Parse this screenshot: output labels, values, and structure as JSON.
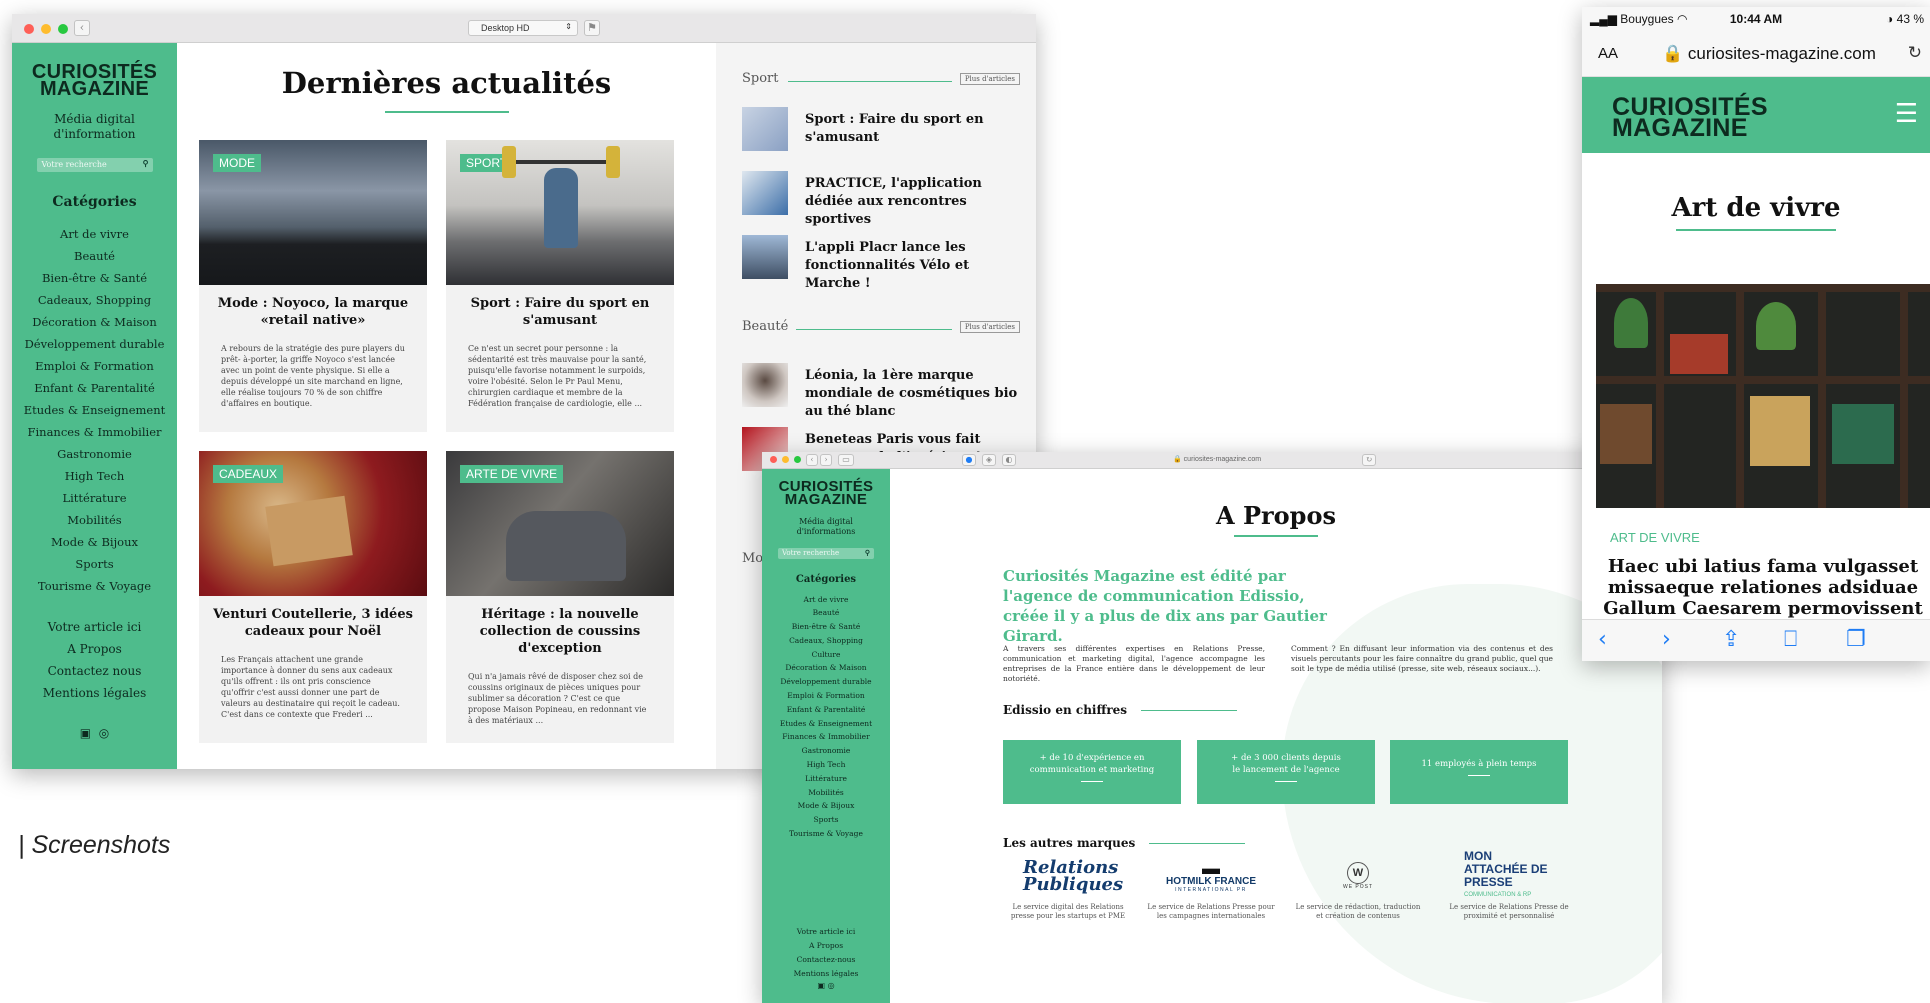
{
  "caption": "| Screenshots",
  "logo": {
    "line1": "CURIOSITÉS",
    "line2": "MAGAZINE"
  },
  "window1": {
    "device_select": "Desktop HD",
    "sidebar": {
      "tagline1": "Média digital",
      "tagline2": "d'information",
      "search_placeholder": "Votre recherche",
      "categories_title": "Catégories",
      "categories": [
        "Art de vivre",
        "Beauté",
        "Bien-être & Santé",
        "Cadeaux, Shopping",
        "Décoration & Maison",
        "Développement durable",
        "Emploi & Formation",
        "Enfant & Parentalité",
        "Etudes & Enseignement",
        "Finances & Immobilier",
        "Gastronomie",
        "High Tech",
        "Littérature",
        "Mobilités",
        "Mode & Bijoux",
        "Sports",
        "Tourisme & Voyage"
      ],
      "extra": [
        "Votre article ici",
        "A Propos",
        "Contactez nous",
        "Mentions légales"
      ]
    },
    "main": {
      "title": "Dernières actualités",
      "cards": [
        {
          "badge": "MODE",
          "title": "Mode : Noyoco, la marque «retail native»",
          "excerpt": "A rebours de la stratégie des pure players du prêt- à-porter, la griffe Noyoco s'est lancée avec un point de vente physique. Si elle a depuis développé un site marchand en ligne, elle réalise toujours 70 % de son chiffre d'affaires en boutique."
        },
        {
          "badge": "SPORT",
          "title": "Sport : Faire du sport en s'amusant",
          "excerpt": "Ce n'est un secret pour personne : la sédentarité est très mauvaise pour la santé, puisqu'elle favorise notamment le surpoids, voire l'obésité. Selon le Pr Paul Menu, chirurgien cardiaque et membre de la Fédération française de cardiologie, elle ..."
        },
        {
          "badge": "CADEAUX",
          "title": "Venturi Coutellerie, 3 idées cadeaux pour Noël",
          "excerpt": "Les Français attachent une grande importance à donner du sens aux cadeaux qu'ils offrent : ils ont pris conscience qu'offrir c'est aussi donner une part de valeurs au destinataire qui reçoit le cadeau. C'est dans ce contexte que Frederi ..."
        },
        {
          "badge": "ARTE DE VIVRE",
          "title": "Héritage : la nouvelle collection de coussins d'exception",
          "excerpt": "Qui n'a jamais rêvé de disposer chez soi de coussins originaux de pièces uniques pour sublimer sa décoration ? C'est ce que propose Maison Popineau, en redonnant vie à des matériaux ..."
        }
      ]
    },
    "rail": {
      "sport_label": "Sport",
      "beaute_label": "Beauté",
      "mode_label": "Mode",
      "more_label": "Plus d'articles",
      "sport_articles": [
        "Sport : Faire du sport en s'amusant",
        "PRACTICE, l'application dédiée aux rencontres sportives",
        "L'appli Placr lance les fonctionnalités Vélo et Marche !"
      ],
      "beaute_articles": [
        "Léonia, la 1ère marque mondiale de cosmétiques bio au thé blanc",
        "Beneteas Paris vous fait rayonner de l'intérieur !"
      ]
    }
  },
  "window2": {
    "url": "curiosites-magazine.com",
    "sidebar": {
      "tagline1": "Média digital",
      "tagline2": "d'informations",
      "search_placeholder": "Votre recherche",
      "categories_title": "Catégories",
      "categories": [
        "Art de vivre",
        "Beauté",
        "Bien-être & Santé",
        "Cadeaux, Shopping",
        "Culture",
        "Décoration & Maison",
        "Développement durable",
        "Emploi & Formation",
        "Enfant & Parentalité",
        "Etudes & Enseignement",
        "Finances & Immobilier",
        "Gastronomie",
        "High Tech",
        "Littérature",
        "Mobilités",
        "Mode & Bijoux",
        "Sports",
        "Tourisme & Voyage"
      ],
      "extra": [
        "Votre article ici",
        "A Propos",
        "Contactez-nous",
        "Mentions légales"
      ]
    },
    "title": "A Propos",
    "lead": "Curiosités Magazine est édité par l'agence de communication Edissio, créée il y a plus de dix ans par Gautier Girard.",
    "col1": "A travers ses différentes expertises en Relations Presse, communication et marketing digital, l'agence accompagne les entreprises de la France entière dans le développement de leur notoriété.",
    "col2": "Comment ? En diffusant leur information via des contenus et des visuels percutants pour les faire connaître du grand public, quel que soit le type de média utilisé (presse, site web, réseaux sociaux...).",
    "stats_title": "Edissio en chiffres",
    "stats": [
      "+ de 10 d'expérience en communication et marketing",
      "+ de 3 000 clients depuis le lancement de l'agence",
      "11 employés à plein temps"
    ],
    "brands_title": "Les autres marques",
    "brands": [
      {
        "name": "Relations Publiques",
        "desc": "Le service digital des Relations presse pour les startups et PME"
      },
      {
        "name": "HOTMILK FRANCE",
        "sub": "INTERNATIONAL PR",
        "desc": "Le service de Relations Presse pour les campagnes internationales"
      },
      {
        "name": "WE POST",
        "desc": "Le service de rédaction, traduction et création de contenus"
      },
      {
        "name": "MON ATTACHÉE DE PRESSE",
        "sub": "COMMUNICATION & RP",
        "desc": "Le service de Relations Presse de proximité et personnalisé"
      }
    ]
  },
  "phone": {
    "carrier": "Bouygues",
    "time": "10:44 AM",
    "battery": "43 %",
    "aa": "AA",
    "url": "curiosites-magazine.com",
    "title": "Art de vivre",
    "category": "ART DE VIVRE",
    "headline": "Haec ubi latius fama vulgasset missaeque relationes adsiduae Gallum Caesarem permovissent"
  }
}
